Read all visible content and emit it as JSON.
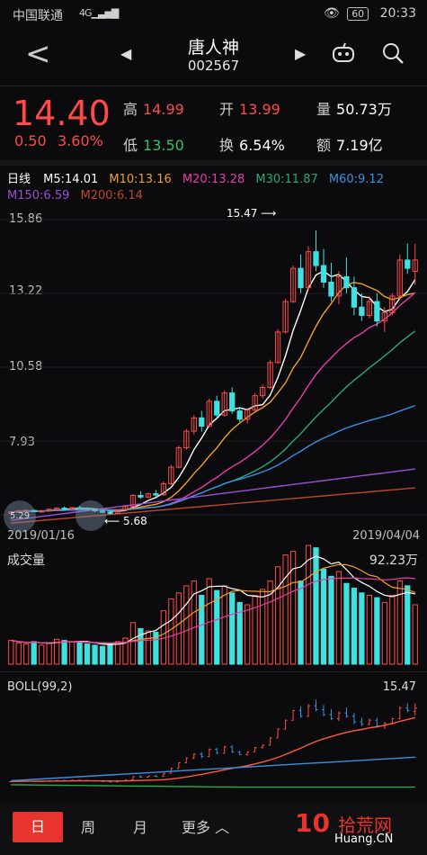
{
  "status_bar": {
    "carrier": "中国联通",
    "signal": "4G",
    "battery": "60",
    "time": "20:33"
  },
  "nav": {
    "stock_name": "唐人神",
    "stock_code": "002567"
  },
  "quote": {
    "price": "14.40",
    "change": "0.50",
    "change_pct": "3.60%",
    "high_label": "高",
    "high": "14.99",
    "open_label": "开",
    "open": "13.99",
    "volume_label": "量",
    "volume": "50.73万",
    "low_label": "低",
    "low": "13.50",
    "turnover_label": "换",
    "turnover": "6.54%",
    "amount_label": "额",
    "amount": "7.19亿"
  },
  "ma_legend": {
    "period": "日线",
    "m5": "M5:14.01",
    "m10": "M10:13.16",
    "m20": "M20:13.28",
    "m30": "M30:11.87",
    "m60": "M60:9.12",
    "m150": "M150:6.59",
    "m200": "M200:6.14"
  },
  "colors": {
    "up": "#ff4a4a",
    "down": "#3fe0e0",
    "m5": "#ffffff",
    "m10": "#f0a02a",
    "m20": "#e83ca8",
    "m30": "#2aa878",
    "m60": "#3a8fe0",
    "m150": "#9b4fd6",
    "m200": "#c0452a"
  },
  "price_axis": {
    "ticks": [
      "15.86",
      "13.22",
      "10.58",
      "7.93"
    ]
  },
  "annotations": {
    "max": "15.47",
    "min": "5.68",
    "zoom_label": "5.29"
  },
  "date_axis": {
    "start": "2019/01/16",
    "end": "2019/04/04"
  },
  "volume_panel": {
    "title": "成交量",
    "max": "92.23万"
  },
  "boll_panel": {
    "title": "BOLL(99,2)",
    "value": "15.47"
  },
  "tabs": {
    "day": "日",
    "week": "周",
    "month": "月",
    "more": "更多"
  },
  "watermark": {
    "text": "拾荒网",
    "domain": "Huang.CN",
    "number": "10"
  },
  "chart_data": {
    "type": "candlestick",
    "ylim": [
      5.2,
      15.86
    ],
    "candles": [
      [
        5.28,
        5.32,
        5.22,
        5.3
      ],
      [
        5.3,
        5.36,
        5.26,
        5.34
      ],
      [
        5.34,
        5.4,
        5.3,
        5.36
      ],
      [
        5.36,
        5.4,
        5.3,
        5.32
      ],
      [
        5.32,
        5.38,
        5.28,
        5.35
      ],
      [
        5.35,
        5.42,
        5.32,
        5.4
      ],
      [
        5.4,
        5.46,
        5.36,
        5.44
      ],
      [
        5.44,
        5.5,
        5.38,
        5.42
      ],
      [
        5.42,
        5.48,
        5.38,
        5.46
      ],
      [
        5.46,
        5.52,
        5.42,
        5.44
      ],
      [
        5.44,
        5.48,
        5.36,
        5.4
      ],
      [
        5.4,
        5.44,
        5.3,
        5.34
      ],
      [
        5.34,
        5.38,
        5.26,
        5.3
      ],
      [
        5.3,
        5.34,
        5.2,
        5.25
      ],
      [
        5.25,
        5.4,
        5.22,
        5.38
      ],
      [
        5.38,
        5.52,
        5.34,
        5.5
      ],
      [
        5.5,
        5.95,
        5.48,
        5.9
      ],
      [
        5.9,
        6.05,
        5.78,
        5.84
      ],
      [
        5.84,
        6.0,
        5.8,
        5.96
      ],
      [
        5.96,
        6.1,
        5.86,
        5.92
      ],
      [
        5.92,
        6.4,
        5.9,
        6.32
      ],
      [
        6.32,
        7.0,
        6.28,
        6.92
      ],
      [
        6.92,
        7.7,
        6.88,
        7.62
      ],
      [
        7.62,
        8.3,
        7.55,
        8.22
      ],
      [
        8.22,
        8.8,
        8.1,
        8.7
      ],
      [
        8.7,
        8.95,
        8.2,
        8.4
      ],
      [
        8.4,
        9.4,
        8.35,
        9.3
      ],
      [
        9.3,
        9.5,
        8.7,
        8.8
      ],
      [
        8.8,
        9.7,
        8.75,
        9.6
      ],
      [
        9.6,
        9.8,
        8.85,
        8.95
      ],
      [
        8.95,
        9.1,
        8.55,
        8.65
      ],
      [
        8.65,
        9.05,
        8.5,
        8.98
      ],
      [
        8.98,
        9.6,
        8.95,
        9.5
      ],
      [
        9.5,
        9.9,
        9.4,
        9.8
      ],
      [
        9.8,
        10.8,
        9.75,
        10.7
      ],
      [
        10.7,
        11.9,
        10.65,
        11.8
      ],
      [
        11.8,
        13.0,
        11.75,
        12.9
      ],
      [
        12.9,
        14.2,
        12.85,
        14.1
      ],
      [
        14.1,
        14.6,
        13.2,
        13.4
      ],
      [
        13.4,
        14.9,
        13.3,
        14.7
      ],
      [
        14.7,
        15.47,
        14.0,
        14.2
      ],
      [
        14.2,
        14.8,
        13.4,
        13.6
      ],
      [
        13.6,
        14.3,
        12.9,
        13.1
      ],
      [
        13.1,
        14.0,
        12.8,
        13.8
      ],
      [
        13.8,
        14.5,
        13.2,
        13.4
      ],
      [
        13.4,
        13.8,
        12.4,
        12.7
      ],
      [
        12.7,
        13.2,
        12.2,
        12.4
      ],
      [
        12.4,
        13.1,
        12.3,
        12.9
      ],
      [
        12.9,
        13.2,
        12.0,
        12.2
      ],
      [
        12.2,
        12.7,
        11.8,
        12.5
      ],
      [
        12.5,
        13.2,
        12.4,
        13.1
      ],
      [
        13.1,
        14.6,
        13.0,
        14.4
      ],
      [
        14.4,
        15.0,
        13.9,
        14.1
      ],
      [
        13.99,
        14.99,
        13.5,
        14.4
      ]
    ],
    "volumes": [
      20,
      18,
      17,
      19,
      16,
      18,
      21,
      20,
      19,
      18,
      17,
      16,
      15,
      17,
      19,
      22,
      35,
      30,
      28,
      27,
      45,
      55,
      60,
      66,
      70,
      58,
      72,
      62,
      66,
      60,
      52,
      50,
      58,
      63,
      70,
      82,
      92,
      95,
      70,
      100,
      98,
      80,
      74,
      78,
      68,
      64,
      60,
      58,
      56,
      52,
      58,
      70,
      66,
      50
    ]
  }
}
